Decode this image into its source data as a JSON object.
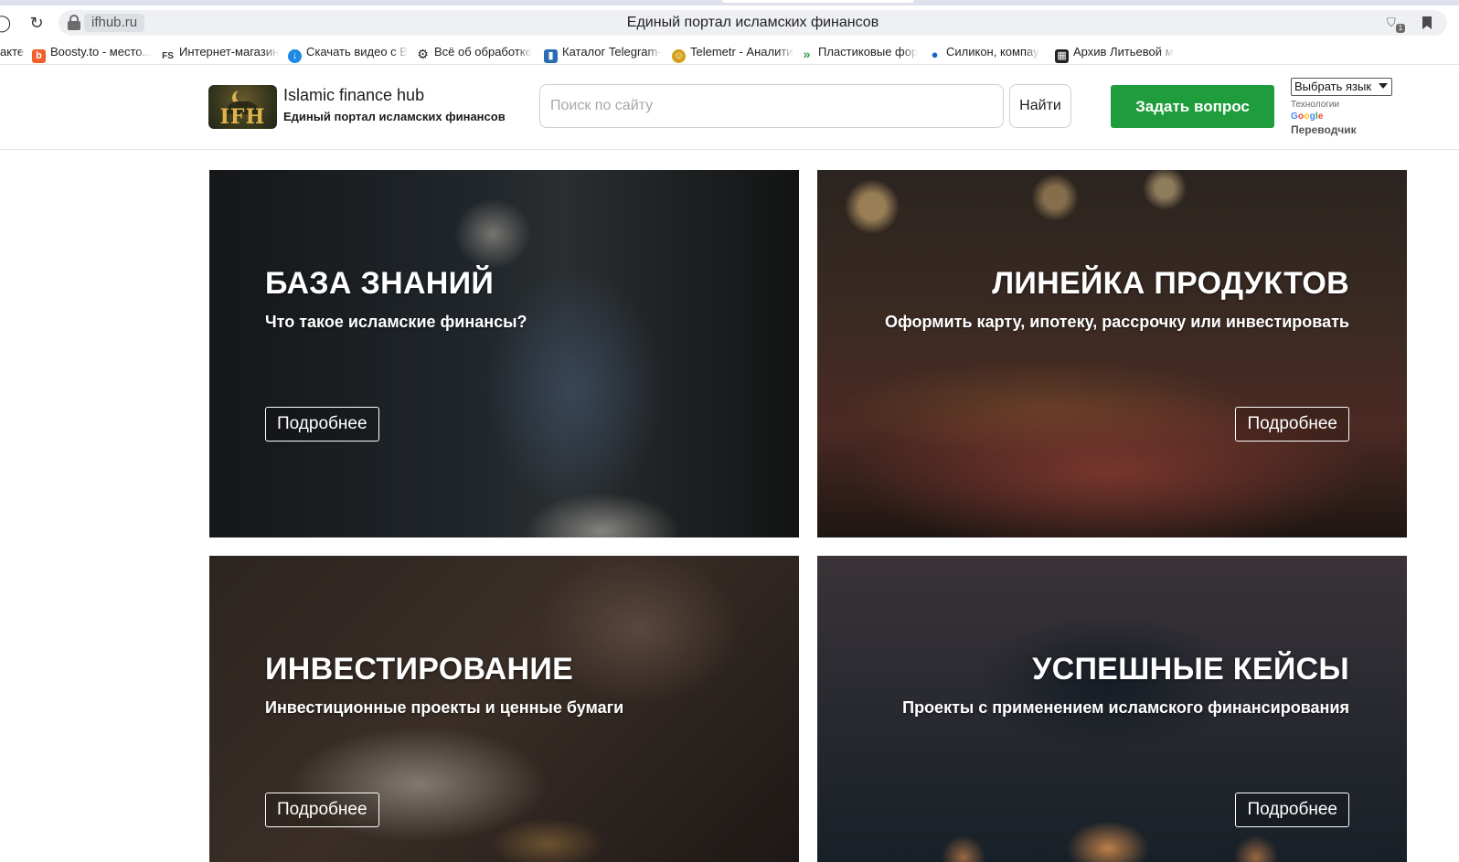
{
  "browser": {
    "domain": "ifhub.ru",
    "tab_title": "Единый портал исламских финансов",
    "back_glyph": "⟳",
    "bookmarks": [
      {
        "label": "акте",
        "icon": "",
        "color": ""
      },
      {
        "label": "Boosty.to - место...",
        "icon": "b",
        "color": "#f15f2c"
      },
      {
        "label": "Интернет-магазин",
        "icon": "FS",
        "color": "#444444"
      },
      {
        "label": "Скачать видео с В",
        "icon": "↓",
        "color": "#1e88e5"
      },
      {
        "label": "Всё об обработке",
        "icon": "⚙",
        "color": "#222222"
      },
      {
        "label": "Каталог Telegram-",
        "icon": "▮",
        "color": "#2b6cb0"
      },
      {
        "label": "Telemetr - Аналити",
        "icon": "☺",
        "color": "#d4a017"
      },
      {
        "label": "Пластиковые фор",
        "icon": "»",
        "color": "#2e9e44"
      },
      {
        "label": "Силикон, компау",
        "icon": "●",
        "color": "#1565c0"
      },
      {
        "label": "Архив Литьевой м",
        "icon": "▦",
        "color": "#222222"
      }
    ]
  },
  "header": {
    "logo_text": "IFH",
    "brand_name": "Islamic finance hub",
    "brand_sub": "Единый портал исламских финансов",
    "search_placeholder": "Поиск по сайту",
    "search_button": "Найти",
    "ask_button": "Задать вопрос",
    "lang_select": "Выбрать язык",
    "powered_by": "Технологии",
    "google_letters": [
      "G",
      "o",
      "o",
      "g",
      "l",
      "e"
    ],
    "translator": "Переводчик"
  },
  "cards": [
    {
      "title": "БАЗА ЗНАНИЙ",
      "subtitle": "Что такое исламские финансы?",
      "button": "Подробнее"
    },
    {
      "title": "ЛИНЕЙКА ПРОДУКТОВ",
      "subtitle": "Оформить карту, ипотеку, рассрочку или инвестировать",
      "button": "Подробнее"
    },
    {
      "title": "ИНВЕСТИРОВАНИЕ",
      "subtitle": "Инвестиционные проекты и ценные бумаги",
      "button": "Подробнее"
    },
    {
      "title": "УСПЕШНЫЕ КЕЙСЫ",
      "subtitle": "Проекты с применением исламского финансирования",
      "button": "Подробнее"
    }
  ],
  "colors": {
    "accent_green": "#1f9d3c",
    "text_dark": "#1c1c1c",
    "card_text": "#ffffff"
  }
}
